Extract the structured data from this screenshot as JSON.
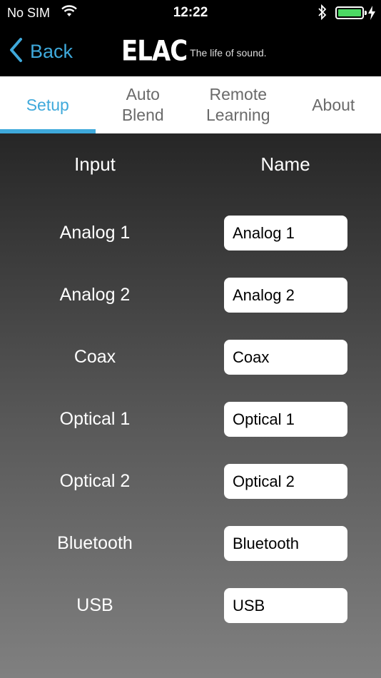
{
  "status_bar": {
    "carrier": "No SIM",
    "time": "12:22",
    "battery_level": 1.0,
    "battery_color": "#4cd964",
    "icons": [
      "wifi-icon",
      "bluetooth-icon",
      "battery-icon",
      "charging-bolt-icon"
    ]
  },
  "nav": {
    "back_label": "Back",
    "brand_logo": "ELAC",
    "brand_tagline": "The life of sound."
  },
  "tabs": [
    {
      "label_line1": "Setup",
      "label_line2": "",
      "active": true
    },
    {
      "label_line1": "Auto",
      "label_line2": "Blend",
      "active": false
    },
    {
      "label_line1": "Remote",
      "label_line2": "Learning",
      "active": false
    },
    {
      "label_line1": "About",
      "label_line2": "",
      "active": false
    }
  ],
  "table": {
    "input_header": "Input",
    "name_header": "Name",
    "rows": [
      {
        "input": "Analog 1",
        "name": "Analog 1"
      },
      {
        "input": "Analog 2",
        "name": "Analog 2"
      },
      {
        "input": "Coax",
        "name": "Coax"
      },
      {
        "input": "Optical 1",
        "name": "Optical 1"
      },
      {
        "input": "Optical 2",
        "name": "Optical 2"
      },
      {
        "input": "Bluetooth",
        "name": "Bluetooth"
      },
      {
        "input": "USB",
        "name": "USB"
      }
    ]
  },
  "colors": {
    "accent": "#3fa9db",
    "nav_background": "#000000",
    "tab_background": "#ffffff",
    "tab_text": "#6a6a6a"
  }
}
